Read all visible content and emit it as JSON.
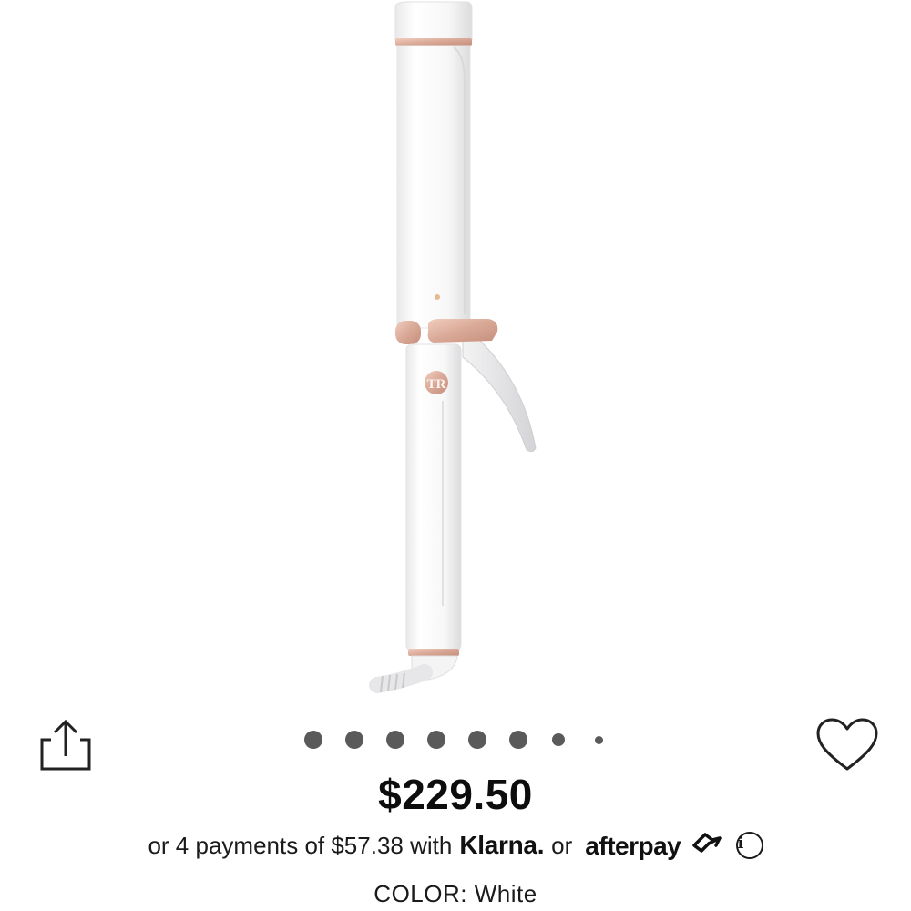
{
  "product": {
    "image_alt": "White curling iron with rose gold accents",
    "price": "$229.50",
    "color_label": "COLOR:",
    "color_value": "White"
  },
  "payments": {
    "prefix": "or 4 payments of $57.38 with",
    "klarna": "Klarna.",
    "or": "or",
    "afterpay": "afterpay"
  },
  "carousel": {
    "total": 8,
    "active": 1
  },
  "icons": {
    "share": "share-icon",
    "favorite": "heart-icon",
    "info": "info-icon",
    "afterpay_mark": "afterpay-arrows-icon"
  },
  "colors": {
    "accent": "#d9a896",
    "dot": "#5a5a5a",
    "text": "#111111"
  }
}
